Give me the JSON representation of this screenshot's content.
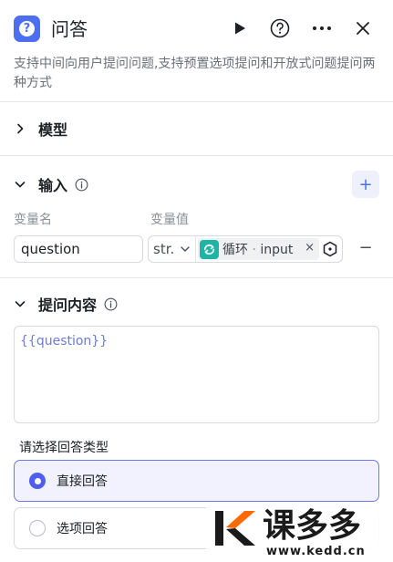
{
  "header": {
    "title": "问答",
    "icon": "question-mark-icon",
    "actions": [
      "play-icon",
      "help-icon",
      "more-icon",
      "close-icon"
    ]
  },
  "description": "支持中间向用户提问问题,支持预置选项提问和开放式问题提问两种方式",
  "sections": {
    "model": {
      "label": "模型"
    },
    "input": {
      "label": "输入",
      "add_label": "+",
      "columns": {
        "name": "变量名",
        "value": "变量值"
      },
      "row": {
        "name": "question",
        "type": "str.",
        "ref_source": "循环",
        "ref_separator": "·",
        "ref_var": "input",
        "clear": "×",
        "remove": "−"
      }
    },
    "prompt": {
      "label": "提问内容",
      "value": "{{question}}"
    }
  },
  "answer_type": {
    "label": "请选择回答类型",
    "options": [
      {
        "label": "直接回答",
        "selected": true
      },
      {
        "label": "选项回答",
        "selected": false
      }
    ]
  },
  "watermark": {
    "text": "课多多",
    "url": "www.kedd.cn"
  },
  "colors": {
    "accent": "#4e6ef2",
    "loop_tag": "#1fb5a6",
    "radio_selected": "#4e5ff0"
  }
}
